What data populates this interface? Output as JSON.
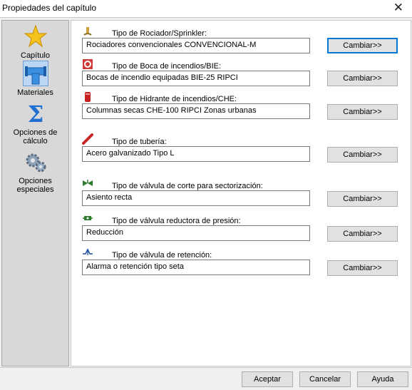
{
  "window": {
    "title": "Propiedades del capítulo",
    "close_glyph": "✕"
  },
  "sidebar": {
    "items": [
      {
        "label": "Capítulo",
        "icon": "star-icon"
      },
      {
        "label": "Materiales",
        "icon": "pipe-icon",
        "selected": true
      },
      {
        "label": "Opciones de cálculo",
        "icon": "sigma-icon"
      },
      {
        "label": "Opciones especiales",
        "icon": "gears-icon"
      }
    ]
  },
  "rows": [
    {
      "label": "Tipo de Rociador/Sprinkler:",
      "value": "Rociadores convencionales CONVENCIONAL-M",
      "button": "Cambiar>>",
      "icon": "sprinkler-icon"
    },
    {
      "label": "Tipo de Boca de incendios/BIE:",
      "value": "Bocas de incendio equipadas BIE-25 RIPCI",
      "button": "Cambiar>>",
      "icon": "hose-cabinet-icon"
    },
    {
      "label": "Tipo de Hidrante de incendios/CHE:",
      "value": "Columnas secas CHE-100 RIPCI Zonas urbanas",
      "button": "Cambiar>>",
      "icon": "hydrant-icon"
    },
    {
      "label": "Tipo de tubería:",
      "value": "Acero galvanizado Tipo L",
      "button": "Cambiar>>",
      "icon": "pipe-segment-icon"
    },
    {
      "label": "Tipo de válvula de corte para sectorización:",
      "value": "Asiento recta",
      "button": "Cambiar>>",
      "icon": "shutoff-valve-icon"
    },
    {
      "label": "Tipo de válvula reductora de presión:",
      "value": "Reducción",
      "button": "Cambiar>>",
      "icon": "pressure-valve-icon"
    },
    {
      "label": "Tipo de válvula de retención:",
      "value": "Alarma o retención tipo seta",
      "button": "Cambiar>>",
      "icon": "check-valve-icon"
    }
  ],
  "footer": {
    "accept": "Aceptar",
    "cancel": "Cancelar",
    "help": "Ayuda"
  }
}
